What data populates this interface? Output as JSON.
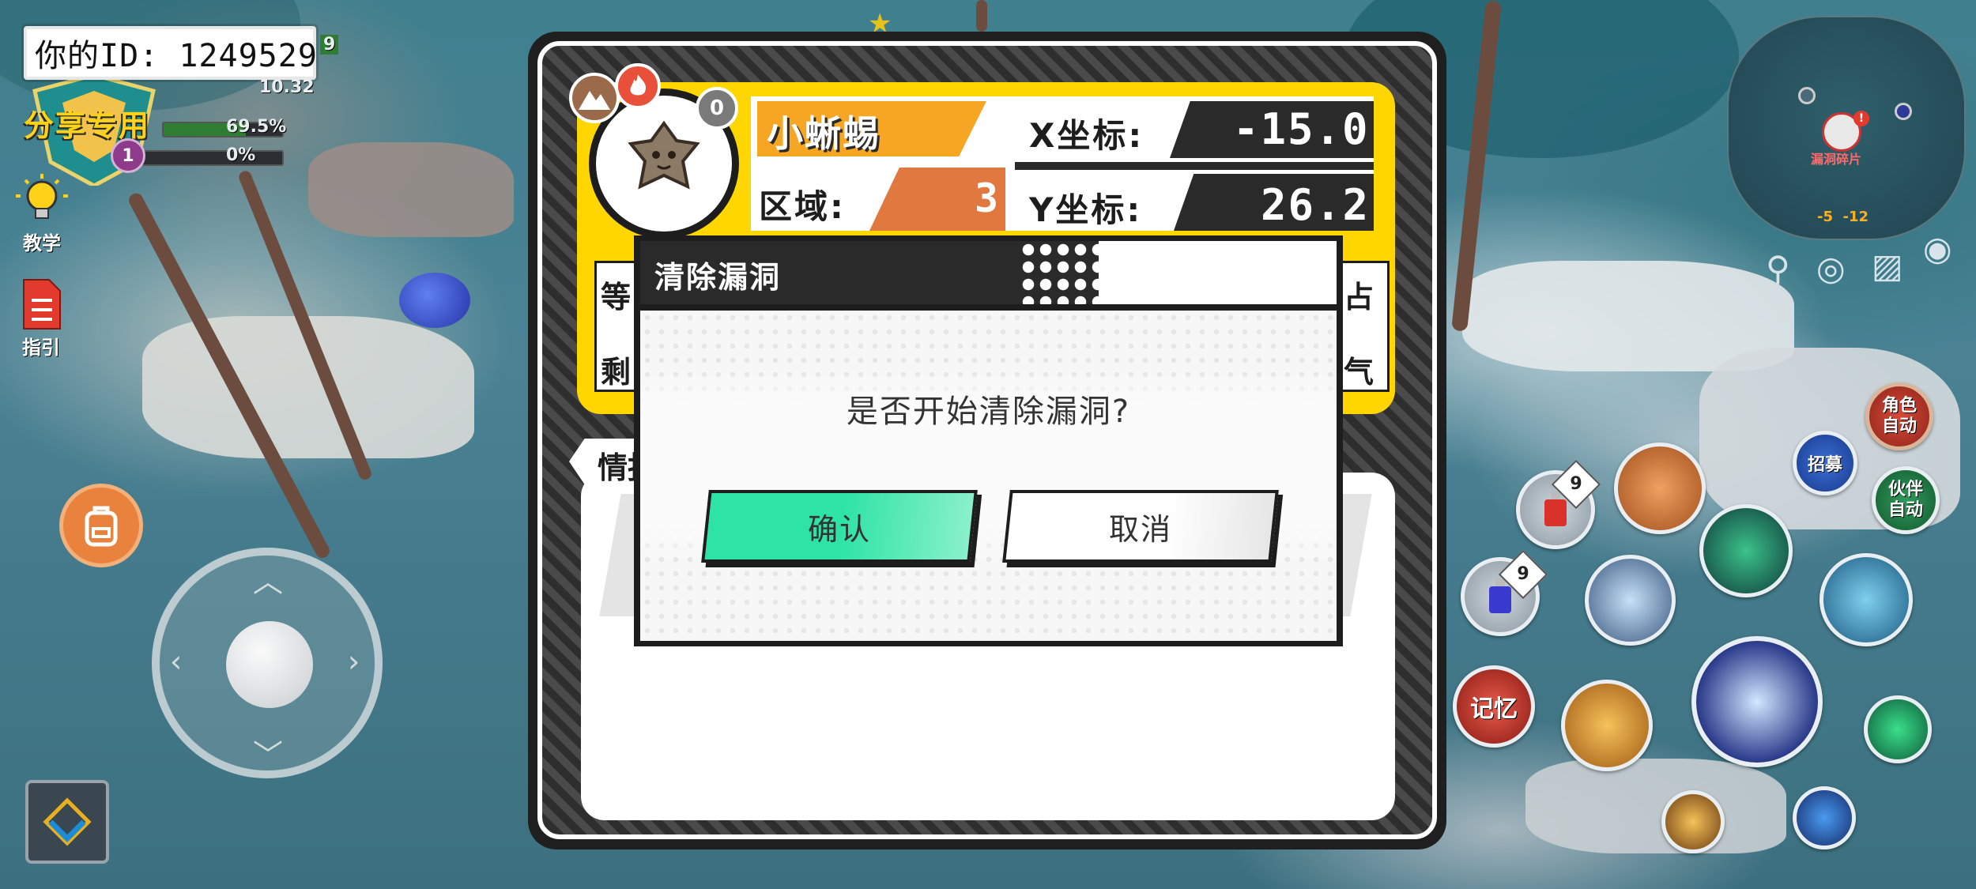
{
  "hud": {
    "player_id_text": "你的ID:  1249529",
    "share_label": "分享专用",
    "level": "1",
    "exp_percent_label": "69.5%",
    "exp_value": 0.695,
    "secondary_percent_label": "0%",
    "secondary_value": 0.0,
    "partial_number_label": "9",
    "partial_stat_label": "10.32",
    "tutorial_label": "教学",
    "guide_label": "指引"
  },
  "minimap": {
    "location_label": "漏洞碎片",
    "coords_label": "-5  -12"
  },
  "skills": {
    "potion_red_count": "9",
    "potion_blue_count": "9",
    "memory_label": "记忆",
    "recruit_label": "招募",
    "char_auto_label": "角色\n自动",
    "partner_auto_label": "伙伴\n自动"
  },
  "card": {
    "creature_name": "小蜥蜴",
    "x_label": "X坐标:",
    "x_value": "-15.0",
    "y_label": "Y坐标:",
    "y_value": "26.2",
    "region_label": "区域:",
    "region_value": "3",
    "lock_glyph": "0",
    "row1_left_char": "等",
    "row1_right_char": "占",
    "row2_left_char": "剩",
    "row2_right_char": "气",
    "info_tab_label": "情报"
  },
  "dialog": {
    "title": "清除漏洞",
    "message": "是否开始清除漏洞?",
    "confirm_label": "确认",
    "cancel_label": "取消"
  },
  "colors": {
    "card_yellow": "#ffd600",
    "name_orange": "#f6a623",
    "region_orange": "#e07840",
    "confirm_green": "#2de3a5",
    "dialog_dark": "#1d1d1d"
  },
  "icons": [
    "star-icon",
    "lightbulb-icon",
    "document-icon",
    "backpack-icon",
    "swap-icon",
    "location-pin-icon",
    "refresh-icon",
    "map-icon",
    "eye-icon",
    "mountain-icon",
    "fire-icon",
    "lock-icon"
  ]
}
